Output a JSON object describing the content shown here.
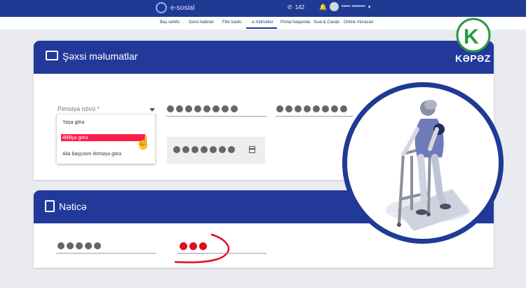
{
  "header": {
    "logo_text": "e-sosial",
    "phone": "142",
    "user_name": "••••• ••••••••"
  },
  "nav": {
    "items": [
      {
        "label": "Baş səhifə",
        "active": false
      },
      {
        "label": "Şəxsi kabinet",
        "active": false
      },
      {
        "label": "Fikir bankı",
        "active": false
      },
      {
        "label": "e-Xidmətlər",
        "active": true
      },
      {
        "label": "Portal haqqında",
        "active": false
      },
      {
        "label": "Sual & Cavab",
        "active": false
      },
      {
        "label": "Online müraciət",
        "active": false
      }
    ]
  },
  "personal": {
    "title": "Şəxsi məlumatlar",
    "pension_label": "Pensiya növü *",
    "dropdown_options": [
      "Yaşa görə",
      "Əlilliyə görə",
      "Ailə başçısını itirməyə görə"
    ],
    "selected_option": "Əlilliyə görə"
  },
  "result": {
    "title": "Nəticə"
  },
  "watermark": {
    "brand": "KƏPƏZ",
    "letter": "K"
  },
  "colors": {
    "primary": "#1f3a93",
    "header": "#22399a",
    "accent_red": "#e10d1d",
    "highlight": "#ff1d4a",
    "brand_green": "#2a9a3f"
  },
  "icons": [
    "phone-icon",
    "bell-icon",
    "profile-card-icon",
    "clipboard-icon",
    "calendar-icon",
    "dropdown-arrow-icon",
    "hand-pointer-icon"
  ]
}
